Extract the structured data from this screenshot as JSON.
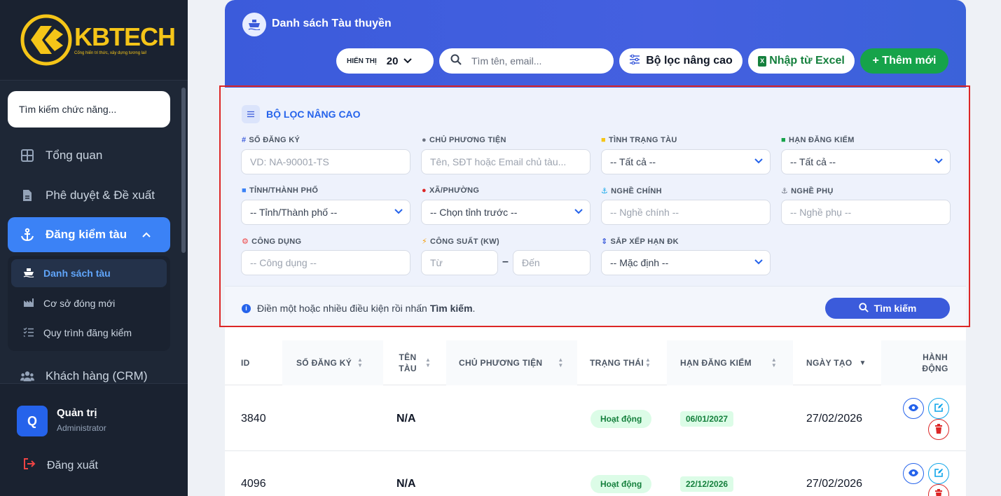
{
  "brand": {
    "name": "KBTECH",
    "tagline": "Cống hiến tri thức, xây dựng tương lai!"
  },
  "sidebar": {
    "search_placeholder": "Tìm kiếm chức năng...",
    "items": [
      {
        "label": "Tổng quan",
        "icon": "grid-icon"
      },
      {
        "label": "Phê duyệt & Đề xuất",
        "icon": "file-icon"
      },
      {
        "label": "Đăng kiểm tàu",
        "icon": "anchor-icon",
        "active": true
      },
      {
        "label": "Khách hàng (CRM)",
        "icon": "users-icon"
      }
    ],
    "sub_items": [
      {
        "label": "Danh sách tàu",
        "icon": "ship-icon",
        "active": true
      },
      {
        "label": "Cơ sở đóng mới",
        "icon": "factory-icon"
      },
      {
        "label": "Quy trình đăng kiểm",
        "icon": "list-check-icon"
      }
    ],
    "user": {
      "initial": "Q",
      "name": "Quản trị",
      "role": "Administrator"
    },
    "logout_label": "Đăng xuất"
  },
  "header": {
    "title": "Danh sách Tàu thuyền",
    "show_label": "HIỂN THỊ",
    "show_value": "20",
    "search_placeholder": "Tìm tên, email...",
    "advanced_filter_label": "Bộ lọc nâng cao",
    "import_label": "Nhập từ Excel",
    "add_label": "+ Thêm mới"
  },
  "filter": {
    "title": "BỘ LỌC NÂNG CAO",
    "fields": {
      "reg_no": {
        "label": "SỐ ĐĂNG KÝ",
        "placeholder": "VD: NA-90001-TS"
      },
      "owner": {
        "label": "CHỦ PHƯƠNG TIỆN",
        "placeholder": "Tên, SĐT hoặc Email chủ tàu..."
      },
      "status": {
        "label": "TÌNH TRẠNG TÀU",
        "value": "-- Tất cả --"
      },
      "expiry": {
        "label": "HẠN ĐĂNG KIỂM",
        "value": "-- Tất cả --"
      },
      "province": {
        "label": "TỈNH/THÀNH PHỐ",
        "value": "-- Tỉnh/Thành phố --"
      },
      "ward": {
        "label": "XÃ/PHƯỜNG",
        "value": "-- Chọn tỉnh trước --"
      },
      "main_job": {
        "label": "NGHỀ CHÍNH",
        "placeholder": "-- Nghề chính --"
      },
      "sub_job": {
        "label": "NGHỀ PHỤ",
        "placeholder": "-- Nghề phụ --"
      },
      "usage": {
        "label": "CÔNG DỤNG",
        "placeholder": "-- Công dụng --"
      },
      "power": {
        "label": "CÔNG SUẤT (KW)",
        "from_placeholder": "Từ",
        "to_placeholder": "Đến",
        "separator": "–"
      },
      "sort": {
        "label": "SẮP XẾP HẠN ĐK",
        "value": "-- Mặc định --"
      }
    },
    "hint_text": "Điền một hoặc nhiều điều kiện rồi nhấn",
    "hint_bold": "Tìm kiếm",
    "hint_end": ".",
    "search_button": "Tìm kiếm"
  },
  "table": {
    "columns": [
      "ID",
      "SỐ ĐĂNG KÝ",
      "TÊN TÀU",
      "CHỦ PHƯƠNG TIỆN",
      "TRẠNG THÁI",
      "HẠN ĐĂNG KIỂM",
      "NGÀY TẠO",
      "HÀNH ĐỘNG"
    ],
    "rows": [
      {
        "id": "3840",
        "reg_no": "",
        "name": "N/A",
        "owner": "",
        "status": "Hoạt động",
        "expiry": "06/01/2027",
        "created": "27/02/2026"
      },
      {
        "id": "4096",
        "reg_no": "",
        "name": "N/A",
        "owner": "",
        "status": "Hoạt động",
        "expiry": "22/12/2026",
        "created": "27/02/2026"
      }
    ]
  },
  "colors": {
    "primary": "#3b5bdb",
    "sidebar": "#1e2736",
    "success": "#16a34a",
    "danger": "#dc2626",
    "logo": "#f5c518"
  }
}
